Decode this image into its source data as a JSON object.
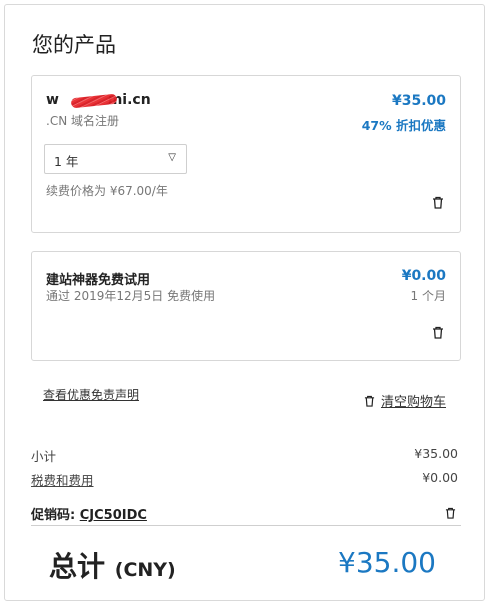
{
  "title": "您的产品",
  "items": [
    {
      "domain_prefix": "w",
      "domain_suffix": "mi.cn",
      "type": ".CN 域名注册",
      "price": "¥35.00",
      "discount": "47% 折扣优惠",
      "period_selected": "1 年",
      "renewal_note": "续费价格为 ¥67.00/年"
    },
    {
      "name": "建站神器免费试用",
      "note": "通过 2019年12月5日 免费使用",
      "price": "¥0.00",
      "duration": "1 个月"
    }
  ],
  "links": {
    "discount_statement": "查看优惠免责声明",
    "clear_cart": "清空购物车"
  },
  "summary": {
    "subtotal_label": "小计",
    "subtotal_value": "¥35.00",
    "tax_label": "税费和费用",
    "tax_value": "¥0.00",
    "promo_label": "促销码:",
    "promo_code": "CJC50IDC",
    "total_label": "总计",
    "total_currency": "(CNY)",
    "total_value": "¥35.00"
  },
  "icons": {
    "trash": "trash-icon",
    "caret": "chevron-down-icon"
  },
  "colors": {
    "accent": "#1b78c2",
    "border": "#d7d7d7",
    "redaction": "#e8272c"
  }
}
